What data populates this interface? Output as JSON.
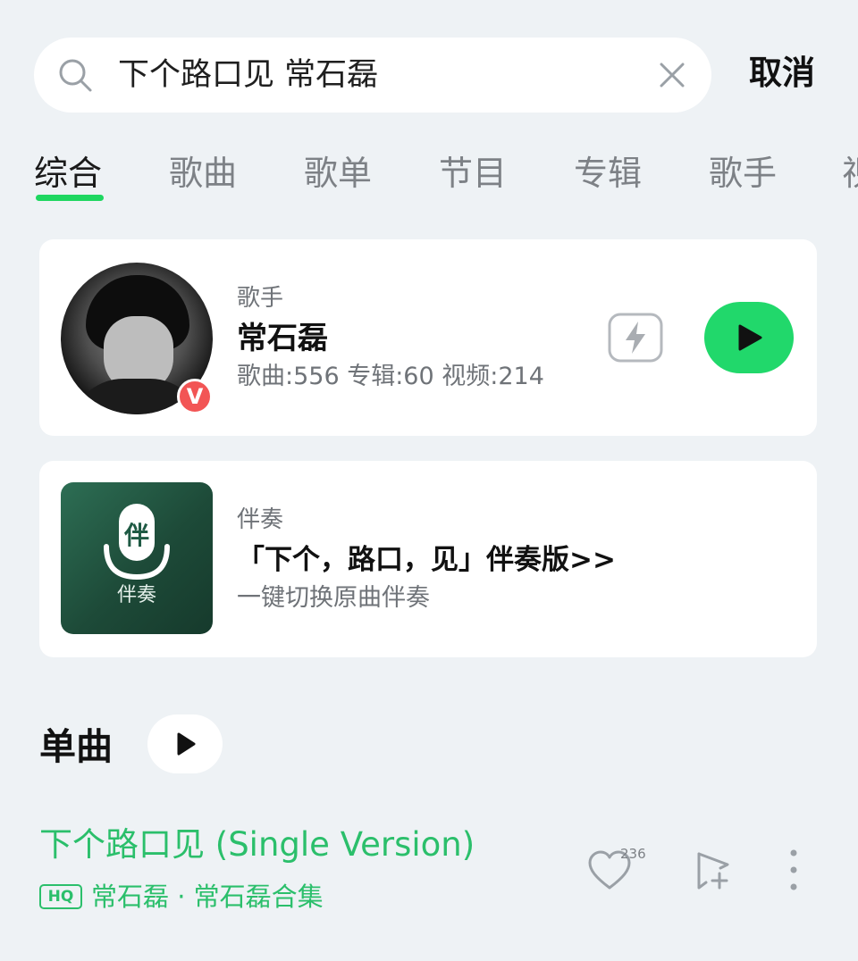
{
  "search": {
    "query": "下个路口见 常石磊",
    "cancel_label": "取消"
  },
  "tabs": [
    {
      "label": "综合",
      "active": true
    },
    {
      "label": "歌曲",
      "active": false
    },
    {
      "label": "歌单",
      "active": false
    },
    {
      "label": "节目",
      "active": false
    },
    {
      "label": "专辑",
      "active": false
    },
    {
      "label": "歌手",
      "active": false
    },
    {
      "label": "视",
      "active": false
    }
  ],
  "artist_card": {
    "kind": "歌手",
    "name": "常石磊",
    "stats": "歌曲:556 专辑:60 视频:214",
    "badge": "V",
    "icons": [
      "avatar",
      "verified-badge-icon",
      "lightning-icon",
      "play-icon"
    ]
  },
  "accompaniment_card": {
    "kind": "伴奏",
    "thumb_char": "伴",
    "thumb_label": "伴奏",
    "title": "「下个，路口，见」伴奏版>>",
    "subtitle": "一键切换原曲伴奏",
    "icons": [
      "microphone-icon"
    ]
  },
  "singles": {
    "section_title": "单曲",
    "songs": [
      {
        "title": "下个路口见 (Single Version)",
        "quality": "HQ",
        "meta": "常石磊 · 常石磊合集",
        "like_count": "236",
        "icons": [
          "heart-icon",
          "add-to-playlist-icon",
          "more-vertical-icon"
        ]
      }
    ]
  },
  "colors": {
    "accent": "#21d86b",
    "song_green": "#2bbf6b",
    "background": "#eef2f5",
    "badge_red": "#f25555"
  }
}
